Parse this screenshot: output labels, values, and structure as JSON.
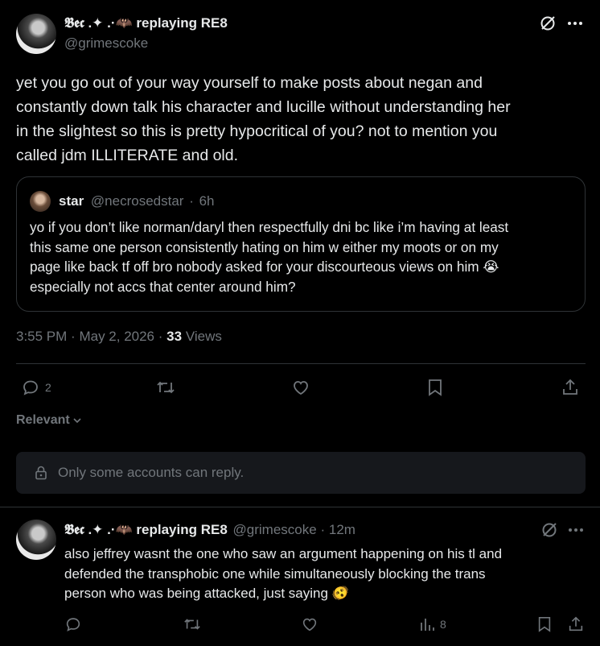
{
  "post": {
    "display_name": "𝕭𝖊𝖈 .✦ .·🦇 replaying RE8",
    "handle": "@grimescoke",
    "text_lines": [
      "yet you go out of your way yourself to make posts about negan and",
      "constantly down talk his character and lucille without understanding her",
      "in the slightest so this is pretty hypocritical of you? not to mention you",
      "called jdm ILLITERATE and old."
    ],
    "quote": {
      "display_name": "star",
      "handle": "@necrosedstar",
      "separator": "·",
      "time": "6h",
      "text_lines": [
        "yo if you don’t like norman/daryl then respectfully dni bc like i’m having at least",
        "this same one person consistently hating on him w either my moots or on my",
        "page like back tf off bro nobody asked for your discourteous views on him 😭",
        "especially not accs that center around him?"
      ]
    },
    "meta": {
      "time": "3:55 PM",
      "sep1": "·",
      "date": "May 2, 2026",
      "sep2": "·",
      "views_count": "33",
      "views_label": "Views"
    },
    "actions": {
      "reply_count": "2"
    },
    "sort_label": "Relevant",
    "reply_restriction": "Only some accounts can reply."
  },
  "reply": {
    "display_name": "𝕭𝖊𝖈 .✦ .·🦇 replaying RE8",
    "handle": "@grimescoke",
    "separator": "·",
    "time": "12m",
    "text_lines": [
      "also jeffrey wasnt the one who saw an argument happening on his tl and",
      "defended the transphobic one while simultaneously blocking the trans",
      "person who was being attacked, just saying 🫨"
    ],
    "views_count": "8"
  },
  "colors": {
    "background": "#000000",
    "text": "#e7e9ea",
    "muted": "#71767b",
    "border": "#2f3336"
  }
}
